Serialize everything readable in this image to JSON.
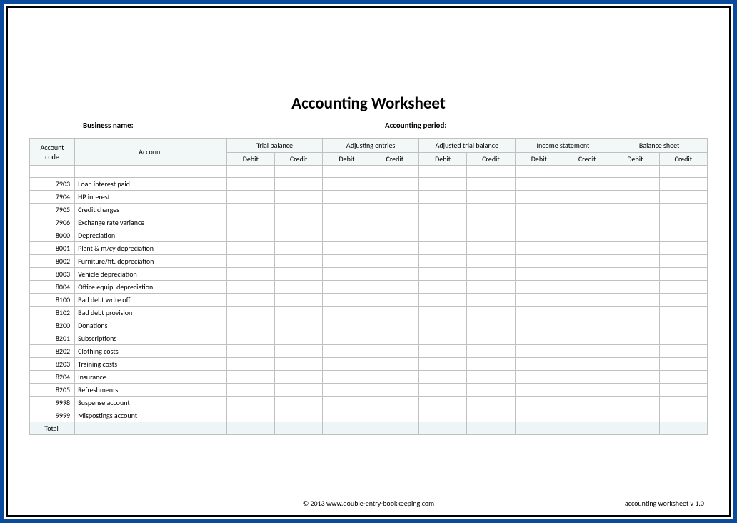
{
  "title": "Accounting Worksheet",
  "labels": {
    "business_name": "Business name:",
    "accounting_period": "Accounting period:"
  },
  "columns": {
    "account_code": "Account code",
    "account": "Account",
    "groups": [
      "Trial balance",
      "Adjusting entries",
      "Adjusted trial balance",
      "Income statement",
      "Balance sheet"
    ],
    "debit": "Debit",
    "credit": "Credit"
  },
  "rows": [
    {
      "code": "7903",
      "account": "Loan interest paid"
    },
    {
      "code": "7904",
      "account": "HP interest"
    },
    {
      "code": "7905",
      "account": "Credit charges"
    },
    {
      "code": "7906",
      "account": "Exchange rate variance"
    },
    {
      "code": "8000",
      "account": "Depreciation"
    },
    {
      "code": "8001",
      "account": "Plant & m/cy depreciation"
    },
    {
      "code": "8002",
      "account": "Furniture/fit. depreciation"
    },
    {
      "code": "8003",
      "account": "Vehicle depreciation"
    },
    {
      "code": "8004",
      "account": "Office equip. depreciation"
    },
    {
      "code": "8100",
      "account": "Bad debt write off"
    },
    {
      "code": "8102",
      "account": "Bad debt provision"
    },
    {
      "code": "8200",
      "account": "Donations"
    },
    {
      "code": "8201",
      "account": "Subscriptions"
    },
    {
      "code": "8202",
      "account": "Clothing costs"
    },
    {
      "code": "8203",
      "account": "Training costs"
    },
    {
      "code": "8204",
      "account": "Insurance"
    },
    {
      "code": "8205",
      "account": "Refreshments"
    },
    {
      "code": "9998",
      "account": "Suspense account"
    },
    {
      "code": "9999",
      "account": "Mispostings account"
    }
  ],
  "total_label": "Total",
  "footer": {
    "copyright": "© 2013 www.double-entry-bookkeeping.com",
    "version": "accounting worksheet v 1.0"
  }
}
